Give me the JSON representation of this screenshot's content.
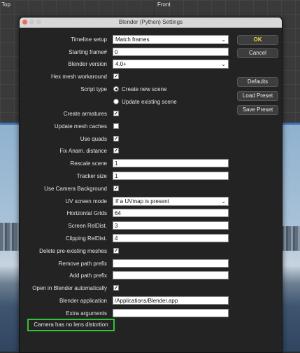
{
  "viewports": {
    "left_label": "Top",
    "right_label": "Front"
  },
  "dialog": {
    "title": "Blender (Python) Settings",
    "buttons": {
      "ok": "OK",
      "cancel": "Cancel",
      "defaults": "Defaults",
      "load_preset": "Load Preset",
      "save_preset": "Save Preset"
    },
    "fields": {
      "timeline_setup": {
        "label": "Timeline setup",
        "value": "Match frames"
      },
      "starting_frame": {
        "label": "Starting frame#",
        "value": "0"
      },
      "blender_version": {
        "label": "Blender version",
        "value": "4.0+"
      },
      "hex_mesh": {
        "label": "Hex mesh workaround",
        "checked": "✓"
      },
      "script_type": {
        "label": "Script type",
        "option_new": "Create new scene",
        "option_update": "Update existing scene"
      },
      "create_armatures": {
        "label": "Create armatures",
        "checked": "✓"
      },
      "update_mesh_caches": {
        "label": "Update mesh caches",
        "checked": ""
      },
      "use_quads": {
        "label": "Use quads",
        "checked": "✓"
      },
      "fix_anam": {
        "label": "Fix Anam. distance",
        "checked": "✓"
      },
      "rescale_scene": {
        "label": "Rescale scene",
        "value": "1"
      },
      "tracker_size": {
        "label": "Tracker size",
        "value": "1"
      },
      "use_camera_bg": {
        "label": "Use Camera Background",
        "checked": "✓"
      },
      "uv_screen_mode": {
        "label": "UV screen mode",
        "value": "If a UVmap is present"
      },
      "horizontal_grids": {
        "label": "Horizontal Grids",
        "value": "64"
      },
      "screen_reldist": {
        "label": "Screen RelDist.",
        "value": "3"
      },
      "clipping_reldist": {
        "label": "Clipping RelDist.",
        "value": "4"
      },
      "delete_meshes": {
        "label": "Delete pre-existing meshes",
        "checked": "✓"
      },
      "remove_path_prefix": {
        "label": "Remove path prefix",
        "value": ""
      },
      "add_path_prefix": {
        "label": "Add path prefix",
        "value": ""
      },
      "open_in_blender": {
        "label": "Open in Blender automatically",
        "checked": "✓"
      },
      "blender_application": {
        "label": "Blender application",
        "value": "/Applications/Blender.app"
      },
      "extra_arguments": {
        "label": "Extra arguments",
        "value": ""
      }
    },
    "status_message": "Camera has no lens distortion"
  },
  "colors": {
    "ok_text": "#f0d040",
    "highlight_border": "#34c23a"
  }
}
